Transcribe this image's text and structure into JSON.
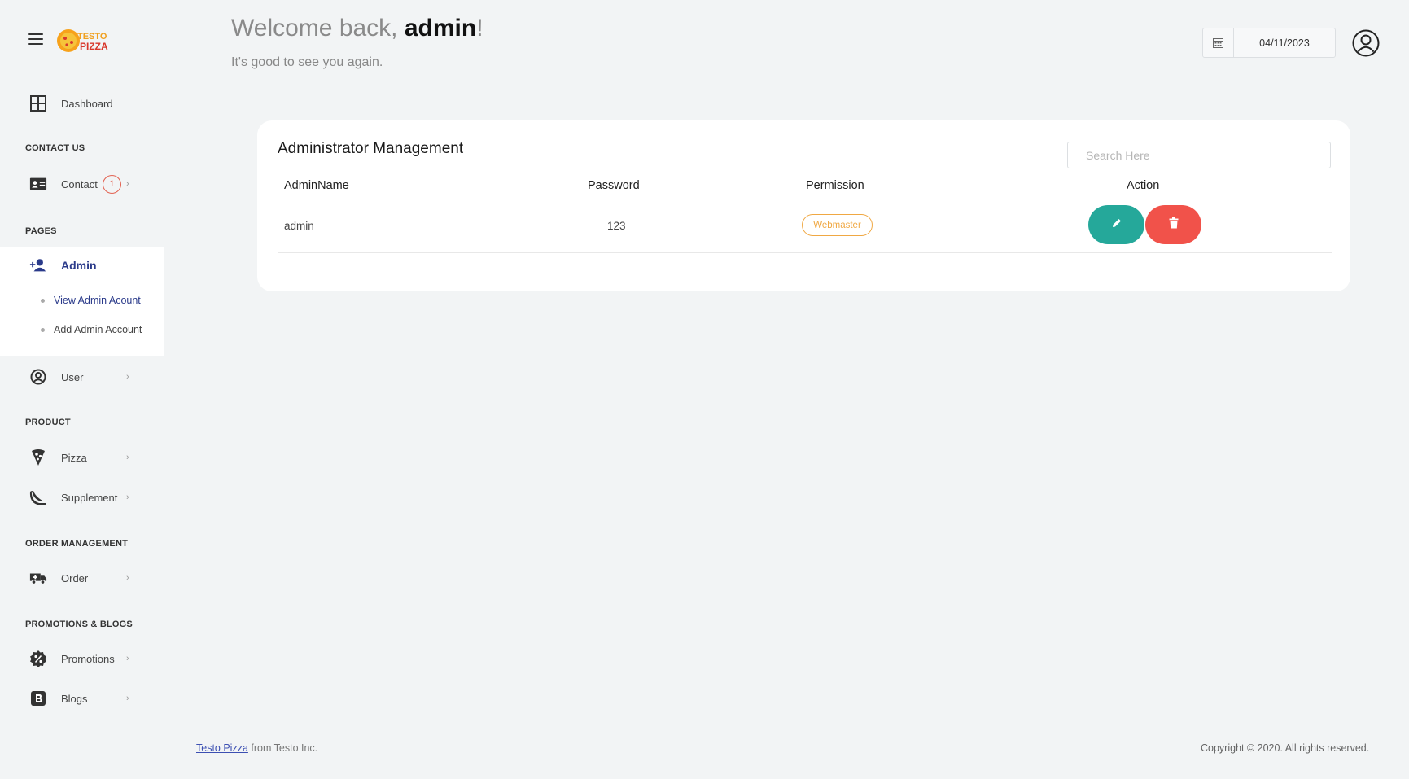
{
  "header": {
    "welcome_prefix": "Welcome back, ",
    "username": "admin",
    "welcome_suffix": "!",
    "subtitle": "It's good to see you again.",
    "date": "04/11/2023"
  },
  "brand": {
    "logo_line1": "TESTO",
    "logo_line2": "PIZZA"
  },
  "sidebar": {
    "dashboard": "Dashboard",
    "sections": {
      "contact": "CONTACT US",
      "pages": "PAGES",
      "product": "PRODUCT",
      "order": "ORDER MANAGEMENT",
      "promo": "PROMOTIONS & BLOGS"
    },
    "contact": {
      "label": "Contact",
      "badge": "1"
    },
    "admin": {
      "label": "Admin",
      "sub": [
        "View Admin Acount",
        "Add Admin Account"
      ]
    },
    "user": "User",
    "pizza": "Pizza",
    "supplement": "Supplement",
    "order": "Order",
    "promotions": "Promotions",
    "blogs": "Blogs",
    "chevron": "›"
  },
  "card": {
    "title": "Administrator Management",
    "search_placeholder": "Search Here",
    "columns": [
      "AdminName",
      "Password",
      "Permission",
      "Action"
    ],
    "rows": [
      {
        "name": "admin",
        "password": "123",
        "permission": "Webmaster"
      }
    ]
  },
  "footer": {
    "link": "Testo Pizza",
    "from": " from Testo Inc.",
    "copyright": "Copyright © 2020. All rights reserved."
  },
  "colors": {
    "accent": "#2a3a8a",
    "edit": "#25a89a",
    "delete": "#f1524a",
    "permission": "#f0a843",
    "badge": "#e2604f"
  }
}
